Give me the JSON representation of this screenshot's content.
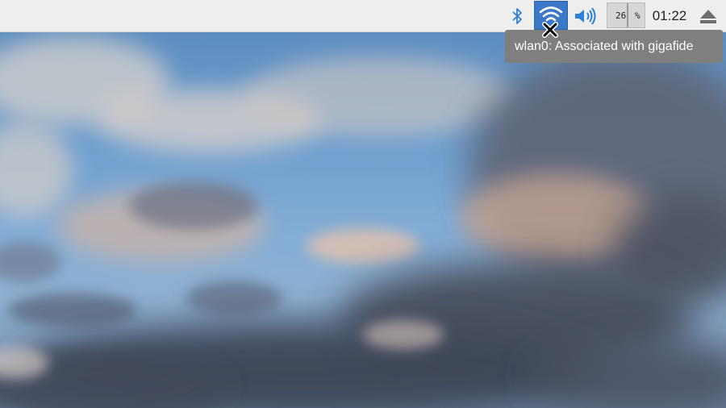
{
  "taskbar": {
    "tray": {
      "bluetooth_icon": "bluetooth-icon",
      "wifi_icon": "wifi-icon",
      "volume_icon": "volume-icon",
      "eject_icon": "eject-icon",
      "cpu_monitor": {
        "value": "26",
        "unit": "%"
      },
      "clock": "01:22"
    }
  },
  "tooltip": {
    "text": "wlan0: Associated with gigafide"
  },
  "cursor": {
    "icon": "x-cursor-icon"
  },
  "colors": {
    "taskbar_bg": "#eeeeee",
    "accent_blue": "#3b78c8",
    "icon_blue": "#2f7fd6",
    "tooltip_bg": "#7f7f7f",
    "tooltip_text": "#ffffff"
  }
}
